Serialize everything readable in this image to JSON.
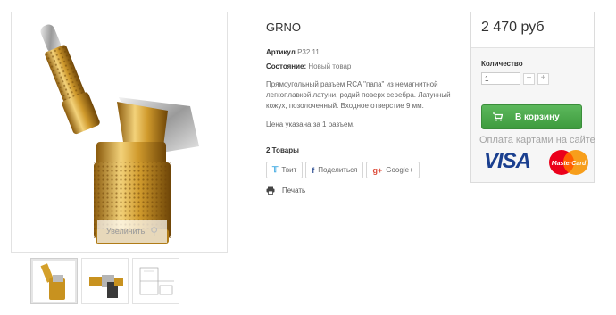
{
  "product": {
    "title": "GRNO",
    "sku_label": "Артикул",
    "sku_value": "P32.11",
    "condition_label": "Состояние:",
    "condition_value": "Новый товар",
    "description": "Прямоугольный разъем RCA \"папа\" из немагнитной легкоплавкой латуни, родий поверх серебра. Латунный кожух, позолоченный. Входное отверстие 9 мм.",
    "price_note": "Цена указана за 1 разъем.",
    "stock": "2 Товары"
  },
  "gallery": {
    "zoom_label": "Увеличить",
    "thumbnail_count": 3
  },
  "share": {
    "twitter": "Твит",
    "facebook": "Поделиться",
    "google": "Google+"
  },
  "print_label": "Печать",
  "buy": {
    "price": "2 470 руб",
    "qty_label": "Количество",
    "qty_value": "1",
    "minus": "−",
    "plus": "+",
    "cart_label": "В корзину",
    "pay_text": "Оплата картами на сайте",
    "visa": "VISA",
    "mastercard": "MasterCard"
  },
  "colors": {
    "gold": "#d4a02a",
    "cart_green": "#4cae4c",
    "visa_blue": "#1a3f8f",
    "mc_red": "#eb001b",
    "mc_orange": "#f79e1b"
  }
}
